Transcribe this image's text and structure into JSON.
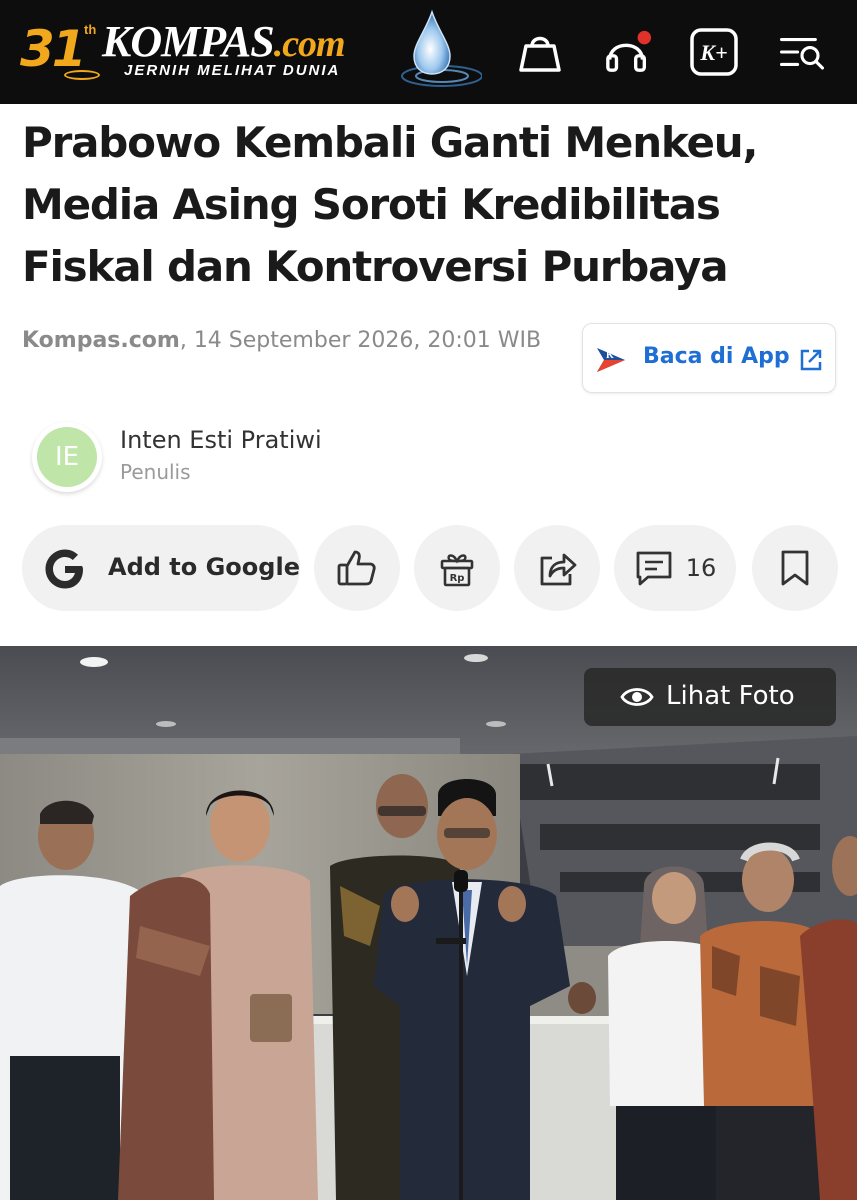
{
  "header": {
    "logo": {
      "anniversary": "31",
      "anniversary_suffix": "th",
      "brand": "KOMPAS",
      "brand_suffix": ".com",
      "tagline": "JERNIH MELIHAT DUNIA"
    },
    "icons": [
      "shopping-bag-icon",
      "headphones-icon",
      "kompas-plus-icon",
      "menu-search-icon"
    ],
    "notification_dot_color": "#e0312b"
  },
  "article": {
    "title": "Prabowo Kembali Ganti Menkeu, Media Asing Soroti Kredibilitas Fiskal dan Kontroversi Purbaya",
    "source": "Kompas.com",
    "datetime": ", 14 September 2026, 20:01 WIB",
    "app_button": "Baca di App",
    "author": {
      "initials": "IE",
      "name": "Inten Esti Pratiwi",
      "role": "Penulis"
    }
  },
  "actions": {
    "google_label": "Add to Google",
    "comment_count": "16"
  },
  "photo": {
    "view_label": "Lihat Foto"
  },
  "colors": {
    "header_bg": "#0d0d0d",
    "brand_orange": "#f2a81d",
    "link_blue": "#1f6ed4",
    "pill_bg": "#f1f1f1",
    "avatar_green": "#bfe5a9"
  }
}
